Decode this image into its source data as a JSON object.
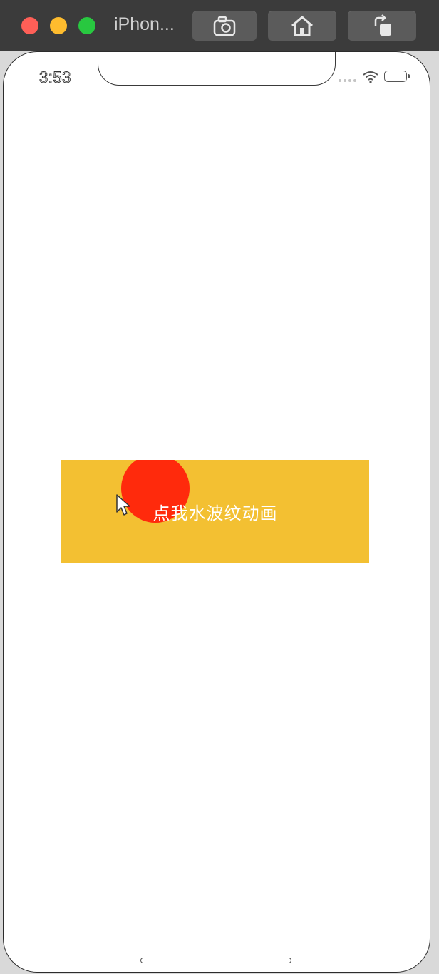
{
  "window": {
    "title": "iPhon...",
    "toolbar": {
      "screenshot_icon": "camera-icon",
      "home_icon": "home-icon",
      "rotate_icon": "rotate-icon"
    }
  },
  "status_bar": {
    "time": "3:53"
  },
  "app": {
    "button_label": "点我水波纹动画",
    "colors": {
      "button_background": "#f3c032",
      "ripple": "#ff2a0c",
      "label": "#ffffff"
    }
  }
}
